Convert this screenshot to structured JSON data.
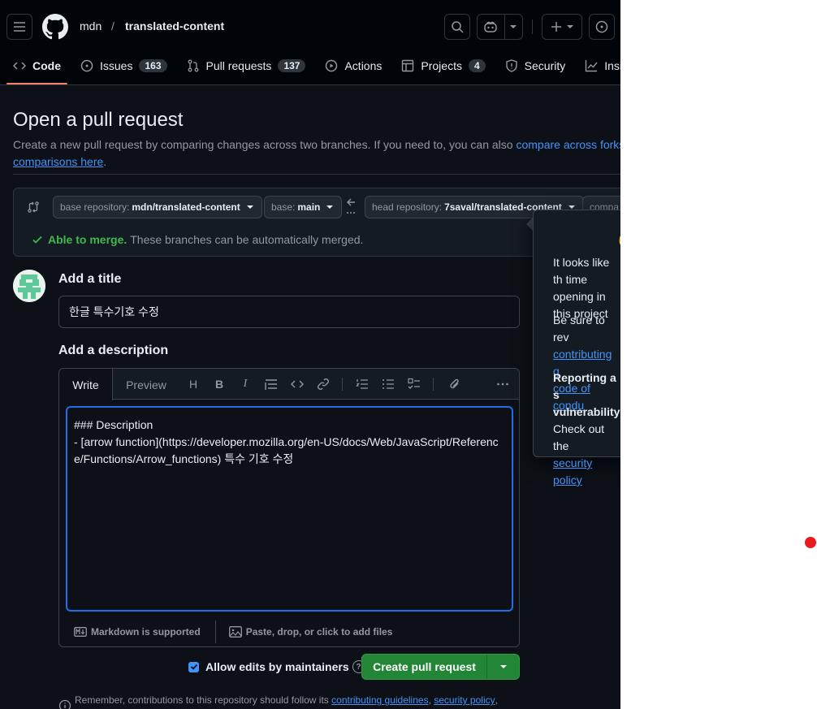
{
  "header": {
    "owner": "mdn",
    "separator": "/",
    "repo": "translated-content"
  },
  "tabs": [
    {
      "label": "Code",
      "icon": "code-icon",
      "count": ""
    },
    {
      "label": "Issues",
      "icon": "issue-icon",
      "count": "163"
    },
    {
      "label": "Pull requests",
      "icon": "pull-request-icon",
      "count": "137"
    },
    {
      "label": "Actions",
      "icon": "play-icon",
      "count": ""
    },
    {
      "label": "Projects",
      "icon": "table-icon",
      "count": "4"
    },
    {
      "label": "Security",
      "icon": "shield-icon",
      "count": ""
    },
    {
      "label": "Insig",
      "icon": "graph-icon",
      "count": ""
    }
  ],
  "page": {
    "title": "Open a pull request",
    "subtitle_text": "Create a new pull request by comparing changes across two branches. If you need to, you can also",
    "subtitle_link1": "compare across forks.",
    "subtitle_link2": "comparisons here",
    "subtitle_end": "."
  },
  "compare": {
    "base_repo_label": "base repository:",
    "base_repo_value": "mdn/translated-content",
    "base_label": "base:",
    "base_value": "main",
    "head_repo_label": "head repository:",
    "head_repo_value": "7saval/translated-content",
    "compare_label": "compa",
    "merge_status": "Able to merge.",
    "merge_text": "These branches can be automatically merged."
  },
  "form": {
    "title_label": "Add a title",
    "title_value": "한글 특수기호 수정",
    "description_label": "Add a description",
    "tab_write": "Write",
    "tab_preview": "Preview",
    "description_value": "### Description\n- [arrow function](https://developer.mozilla.org/en-US/docs/Web/JavaScript/Reference/Functions/Arrow_functions) 특수 기호 수정",
    "markdown_note": "Markdown is supported",
    "attach_note": "Paste, drop, or click to add files",
    "allow_edits": "Allow edits by maintainers",
    "create_button": "Create pull request",
    "remember_text": "Remember, contributions to this repository should follow its",
    "remember_link1": "contributing guidelines",
    "remember_link2": "security policy",
    "remember_end": ","
  },
  "popover": {
    "p1": "It looks like th time opening in this project",
    "p2_text": "Be sure to rev",
    "p2_link1": "contributing g",
    "p2_link2": "code of condu",
    "p3_bold": "Reporting a s vulnerability?",
    "p3_text": "Check out the",
    "p3_link": "security policy"
  },
  "colors": {
    "bg": "#0d1117",
    "header_bg": "#010409",
    "accent_link": "#4493f8",
    "success": "#3fb950",
    "button_green": "#238636",
    "active_tab": "#f78166"
  }
}
